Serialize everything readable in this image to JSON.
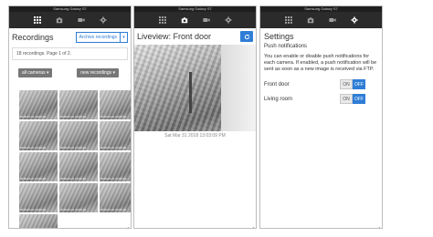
{
  "status_bar": {
    "device": "Samsung Galaxy S7"
  },
  "nav": {
    "icons": [
      "grid-icon",
      "camera-icon",
      "video-icon",
      "gear-icon"
    ]
  },
  "recordings": {
    "title": "Recordings",
    "archive_label": "Archive recordings",
    "count_text": "18 recordings. Page 1 of 2.",
    "filter_camera": "all cameras",
    "filter_new": "new recordings",
    "thumbnails": [
      "2018-03-31 13:03:19",
      "2018-03-31 13:03:19",
      "2018-03-31 13:03:19",
      "2018-03-31 13:03:19",
      "2018-03-31 13:03:19",
      "2018-03-31 13:03:19",
      "2018-03-31 13:03:19",
      "2018-03-31 13:03:19",
      "2018-03-31 13:03:19",
      "2018-03-31 13:03:19",
      "2018-03-31 13:03:19",
      "2018-03-31 13:03:19",
      "2018-03-31 13:03:19"
    ]
  },
  "liveview": {
    "title": "Liveview: Front door",
    "timestamp": "Sat Mar 31 2018 13:03:09 PM"
  },
  "settings": {
    "title": "Settings",
    "subtitle": "Push notifications",
    "description": "You can enable or disable push notifications for each camera. If enabled, a push notification will be sent as soon as a new image is received via FTP.",
    "cameras": [
      {
        "label": "Front door",
        "on": "ON",
        "off": "OFF"
      },
      {
        "label": "Living room",
        "on": "ON",
        "off": "OFF"
      }
    ]
  },
  "colors": {
    "accent": "#2f7dd6",
    "navbar": "#2b2b2b"
  }
}
